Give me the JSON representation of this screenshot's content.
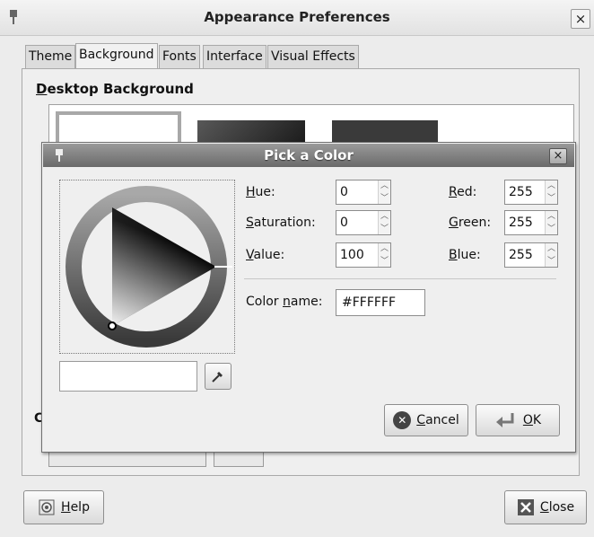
{
  "main_window": {
    "title": "Appearance Preferences",
    "close_glyph": "×",
    "tabs": [
      {
        "label": "Theme"
      },
      {
        "label": "Background"
      },
      {
        "label": "Fonts"
      },
      {
        "label": "Interface"
      },
      {
        "label": "Visual Effects"
      }
    ],
    "active_tab": "Background",
    "section_title": "Desktop Background",
    "partial_label": "C",
    "help_label": "Help",
    "close_label": "Close"
  },
  "color_dialog": {
    "title": "Pick a Color",
    "close_glyph": "×",
    "fields": {
      "hue": {
        "label": "Hue:",
        "value": "0"
      },
      "saturation": {
        "label": "Saturation:",
        "value": "0"
      },
      "value": {
        "label": "Value:",
        "value": "100"
      },
      "red": {
        "label": "Red:",
        "value": "255"
      },
      "green": {
        "label": "Green:",
        "value": "255"
      },
      "blue": {
        "label": "Blue:",
        "value": "255"
      }
    },
    "color_name_label": "Color name:",
    "color_name_value": "#FFFFFF",
    "cancel_label": "Cancel",
    "ok_label": "OK",
    "current_color": "#ffffff"
  },
  "icons": {
    "eyedropper": "eyedropper-icon",
    "cancel": "cancel-icon",
    "ok": "ok-icon",
    "help": "help-icon",
    "close": "close-icon"
  }
}
